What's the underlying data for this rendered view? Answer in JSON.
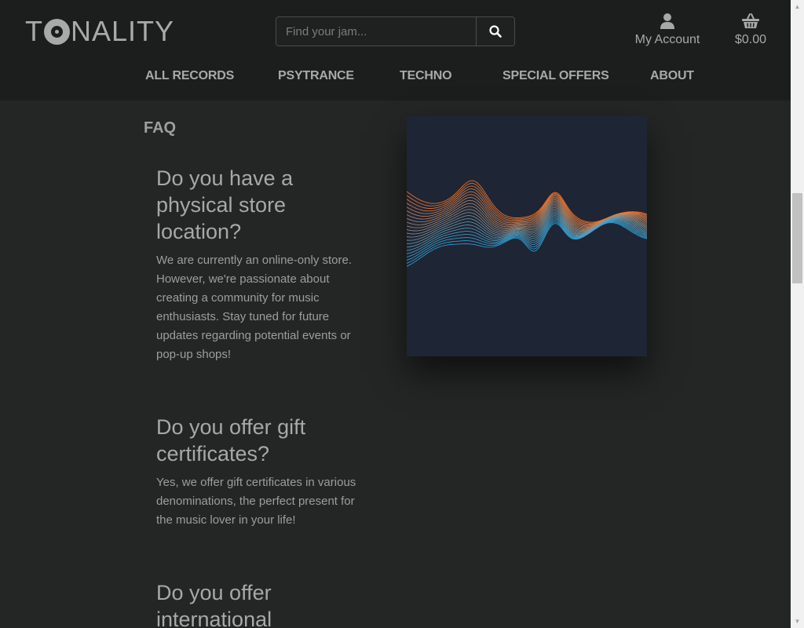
{
  "header": {
    "logo_text_1": "T",
    "logo_text_2": "NALITY",
    "search": {
      "placeholder": "Find your jam...",
      "value": ""
    },
    "account_label": "My Account",
    "basket_total": "$0.00"
  },
  "nav": {
    "items": [
      {
        "label": "ALL RECORDS"
      },
      {
        "label": "PSYTRANCE"
      },
      {
        "label": "TECHNO"
      },
      {
        "label": "SPECIAL OFFERS"
      },
      {
        "label": "ABOUT"
      }
    ]
  },
  "main": {
    "section_title": "FAQ",
    "faqs": [
      {
        "question": "Do you have a physical store location?",
        "answer": "We are currently an online-only store. However, we're passionate about creating a community for music enthusiasts. Stay tuned for future updates regarding potential events or pop-up shops!"
      },
      {
        "question": "Do you offer gift certificates?",
        "answer": "Yes, we offer gift certificates in various denominations, the perfect present for the music lover in your life!"
      },
      {
        "question": "Do you offer international",
        "answer": ""
      }
    ]
  },
  "icons": {
    "search": "search-icon",
    "account": "user-icon",
    "basket": "basket-icon",
    "logo_disc": "vinyl-disc-icon"
  },
  "colors": {
    "header_bg": "#1c1d1d",
    "page_bg": "#242525",
    "text": "#a8a8a8",
    "art_bg": "#1e2535"
  }
}
